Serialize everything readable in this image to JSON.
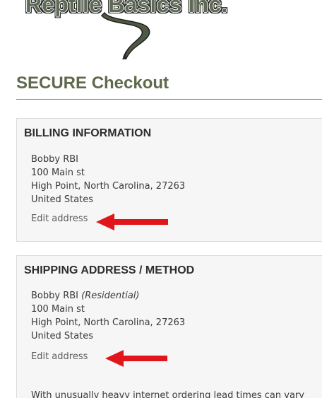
{
  "logo": {
    "text": "Reptile Basics Inc.",
    "snake_icon": "snake-tail-icon"
  },
  "page_title": "SECURE Checkout",
  "billing": {
    "heading": "BILLING INFORMATION",
    "name": "Bobby RBI",
    "street": "100 Main st",
    "city_line": "High Point, North Carolina, 27263",
    "country": "United States",
    "edit_label": "Edit address",
    "arrow_icon": "red-arrow-left-icon"
  },
  "shipping": {
    "heading": "SHIPPING ADDRESS / METHOD",
    "name": "Bobby RBI",
    "address_type": "(Residential)",
    "street": "100 Main st",
    "city_line": "High Point, North Carolina, 27263",
    "country": "United States",
    "edit_label": "Edit address",
    "arrow_icon": "red-arrow-left-icon",
    "notice": "With unusually heavy internet ordering lead times can vary"
  },
  "colors": {
    "heading_green": "#5f6a4c",
    "panel_bg": "#f6f6f6",
    "arrow_red": "#e0161b"
  }
}
